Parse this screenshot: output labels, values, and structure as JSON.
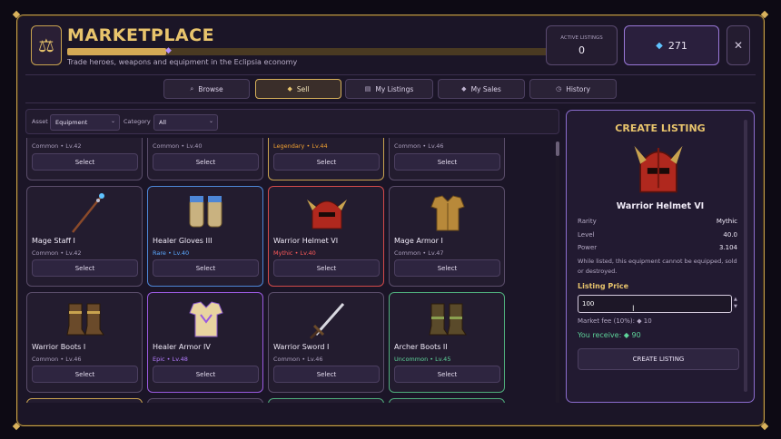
{
  "header": {
    "title": "MARKETPLACE",
    "subtitle": "Trade heroes, weapons and equipment in the Eclipsia economy",
    "progress_fraction": 0.2,
    "active_listings_label": "ACTIVE LISTINGS",
    "active_listings_value": "0",
    "gems": "271",
    "close_glyph": "✕",
    "logo_icon": "scales-icon"
  },
  "tabs": [
    {
      "label": "Browse",
      "icon": "search-icon",
      "glyph": "⌕"
    },
    {
      "label": "Sell",
      "icon": "diamond-icon",
      "glyph": "◆"
    },
    {
      "label": "My Listings",
      "icon": "list-icon",
      "glyph": "▤"
    },
    {
      "label": "My Sales",
      "icon": "diamond-icon",
      "glyph": "◆"
    },
    {
      "label": "History",
      "icon": "clock-icon",
      "glyph": "◷"
    }
  ],
  "filters": {
    "asset_label": "Asset",
    "asset_value": "Equipment",
    "category_label": "Category",
    "category_value": "All"
  },
  "colors": {
    "common": "#a99dbb",
    "rare": "#5aa9ff",
    "epic": "#b47cff",
    "legendary": "#f0a030",
    "mythic": "#ff5a5a",
    "uncommon": "#5ed49a"
  },
  "cards_top": [
    {
      "meta": "Common • Lv.42",
      "rarity": "common",
      "button": "Select"
    },
    {
      "meta": "Common • Lv.40",
      "rarity": "common",
      "button": "Select"
    },
    {
      "meta": "Legendary • Lv.44",
      "rarity": "legendary",
      "button": "Select"
    },
    {
      "meta": "Common • Lv.46",
      "rarity": "common",
      "button": "Select"
    }
  ],
  "cards_mid": [
    {
      "name": "Mage Staff I",
      "meta": "Common • Lv.42",
      "rarity": "common",
      "button": "Select",
      "icon": "staff-icon"
    },
    {
      "name": "Healer Gloves III",
      "meta": "Rare • Lv.40",
      "rarity": "rare",
      "button": "Select",
      "icon": "gloves-icon"
    },
    {
      "name": "Warrior Helmet VI",
      "meta": "Mythic • Lv.40",
      "rarity": "mythic",
      "button": "Select",
      "icon": "helmet-icon"
    },
    {
      "name": "Mage Armor I",
      "meta": "Common • Lv.47",
      "rarity": "common",
      "button": "Select",
      "icon": "armor-icon"
    }
  ],
  "cards_bottom": [
    {
      "name": "Warrior Boots I",
      "meta": "Common • Lv.46",
      "rarity": "common",
      "button": "Select",
      "icon": "boots-icon"
    },
    {
      "name": "Healer Armor IV",
      "meta": "Epic • Lv.48",
      "rarity": "epic",
      "button": "Select",
      "icon": "armor-icon"
    },
    {
      "name": "Warrior Sword I",
      "meta": "Common • Lv.46",
      "rarity": "common",
      "button": "Select",
      "icon": "sword-icon"
    },
    {
      "name": "Archer Boots II",
      "meta": "Uncommon • Lv.45",
      "rarity": "uncommon",
      "button": "Select",
      "icon": "boots-icon"
    }
  ],
  "panel": {
    "title": "CREATE LISTING",
    "item_name": "Warrior Helmet VI",
    "rarity_label": "Rarity",
    "rarity_value": "Mythic",
    "level_label": "Level",
    "level_value": "40.0",
    "power_label": "Power",
    "power_value": "3.104",
    "note": "While listed, this equipment cannot be equipped, sold or destroyed.",
    "price_label": "Listing Price",
    "price_value": "100",
    "fee_text": "Market fee (10%): ◆ 10",
    "receive_text": "You receive: ◆ 90",
    "create_button": "CREATE LISTING"
  }
}
